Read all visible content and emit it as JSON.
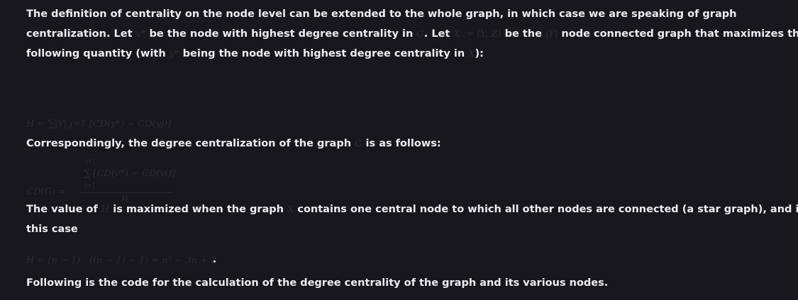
{
  "paragraph1": {
    "line1": "The definition of centrality on the node level can be extended to the whole graph, in which case we are speaking of graph",
    "line2_a": "centralization. Let",
    "line2_m1": "v*",
    "line2_b": "be the node with highest degree centrality in",
    "line2_m2": "G",
    "line2_c": ". Let",
    "line2_m3": "X := (Y, Z)",
    "line2_d": "be the",
    "line2_m4": "|Y|",
    "line2_e": "node connected graph that maximizes the",
    "line3_a": "following quantity (with",
    "line3_m1": "y*",
    "line3_b": "being the node with highest degree centrality in",
    "line3_m2": "X",
    "line3_c": "):"
  },
  "formula_h": "H = ∑|Y| j=1 [CD(y*) − CD(yj)]",
  "paragraph2": {
    "text_a": "Correspondingly, the degree centralization of the graph",
    "m1": "G",
    "text_b": "is as follows:"
  },
  "formula_cd": {
    "lhs": "CD(G) =",
    "numerator": "∑ [CD(v*) − CD(vi)]",
    "sum_top": "|V|",
    "sum_bottom": "i=1",
    "denominator": "H"
  },
  "paragraph3": {
    "text_a": "The value of",
    "m1": "H",
    "text_b": "is maximized when the graph",
    "m2": "X",
    "text_c": "contains one central node to which all other nodes are connected (a star graph), and in",
    "line2": "this case"
  },
  "formula_star": "H = (n − 1) · ((n − 1) − 1) = n² − 3n + 2",
  "paragraph4": "Following is the code for the calculation of the degree centrality of the graph and its various nodes."
}
